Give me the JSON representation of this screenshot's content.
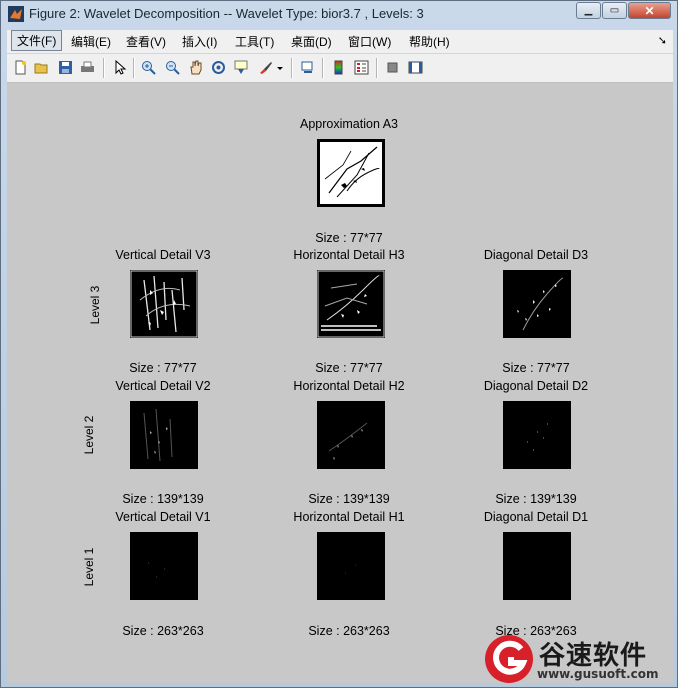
{
  "window": {
    "title": "Figure 2: Wavelet Decomposition -- Wavelet Type: bior3.7 , Levels: 3"
  },
  "menu": [
    "文件(F)",
    "编辑(E)",
    "查看(V)",
    "插入(I)",
    "工具(T)",
    "桌面(D)",
    "窗口(W)",
    "帮助(H)"
  ],
  "toolbar_icons": [
    "new-figure-icon",
    "open-file-icon",
    "save-icon",
    "print-icon",
    "pointer-icon",
    "zoom-in-icon",
    "zoom-out-icon",
    "pan-icon",
    "rotate-3d-icon",
    "data-cursor-icon",
    "brush-icon",
    "brush-dropdown-icon",
    "link-plot-icon",
    "colorbar-icon",
    "legend-icon",
    "hide-plot-tools-icon",
    "show-plot-tools-icon"
  ],
  "approximation": {
    "title": "Approximation A3",
    "size": "Size : 77*77"
  },
  "levels": [
    {
      "label": "Level 3",
      "size": "Size : 77*77",
      "details": [
        "Vertical Detail V3",
        "Horizontal Detail H3",
        "Diagonal Detail D3"
      ]
    },
    {
      "label": "Level 2",
      "size": "Size : 139*139",
      "details": [
        "Vertical Detail V2",
        "Horizontal Detail H2",
        "Diagonal Detail D2"
      ]
    },
    {
      "label": "Level 1",
      "size": "Size : 263*263",
      "details": [
        "Vertical Detail V1",
        "Horizontal Detail H1",
        "Diagonal Detail D1"
      ]
    }
  ],
  "watermark": {
    "brand": "谷速软件",
    "url": "www.gusuoft.com"
  }
}
